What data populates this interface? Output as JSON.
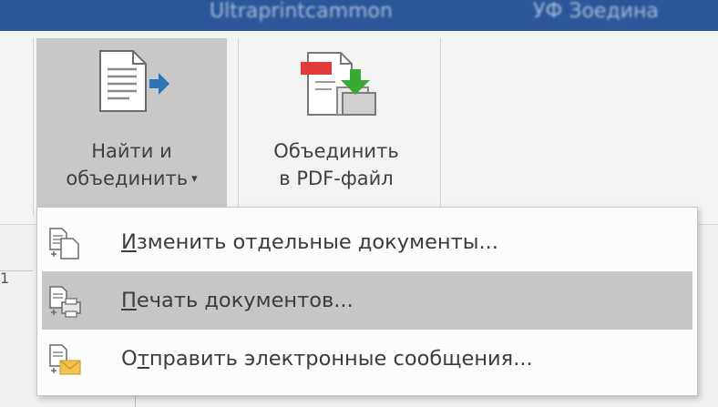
{
  "titlebar": {
    "blurred_text_left": "Ultraprintcammon",
    "blurred_text_right": "УФ Зоедина"
  },
  "ribbon": {
    "find_merge": {
      "line1": "Найти и",
      "line2": "объединить",
      "dropdown_glyph": "▾",
      "icon": "document-arrow-icon"
    },
    "merge_pdf": {
      "line1": "Объединить",
      "line2": "в PDF-файл",
      "icon": "pdf-merge-icon"
    }
  },
  "below": {
    "stub_text": "1"
  },
  "menu": {
    "items": [
      {
        "accel": "И",
        "rest": "зменить отдельные документы...",
        "icon": "edit-documents-icon",
        "hover": false
      },
      {
        "accel": "П",
        "rest": "ечать документов...",
        "icon": "print-documents-icon",
        "hover": true
      },
      {
        "pre": "О",
        "accel": "т",
        "rest": "править электронные сообщения...",
        "icon": "send-email-icon",
        "hover": false
      }
    ]
  },
  "colors": {
    "titlebar": "#2b579a",
    "pdf_red": "#e23a3a",
    "arrow_green": "#3aaa35",
    "arrow_blue": "#2e75b6",
    "envelope": "#f1c24e",
    "hover": "#c6c6c6"
  }
}
